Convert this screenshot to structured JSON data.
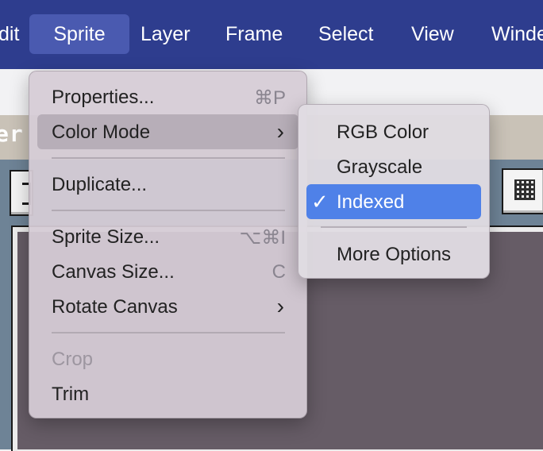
{
  "menubar": {
    "items": [
      "dit",
      "Sprite",
      "Layer",
      "Frame",
      "Select",
      "View",
      "Winde"
    ],
    "active": "Sprite"
  },
  "background": {
    "panel_title": "er"
  },
  "sprite_menu": {
    "properties": {
      "label": "Properties...",
      "shortcut": "⌘P"
    },
    "color_mode": {
      "label": "Color Mode"
    },
    "duplicate": {
      "label": "Duplicate..."
    },
    "sprite_size": {
      "label": "Sprite Size...",
      "shortcut": "⌥⌘I"
    },
    "canvas_size": {
      "label": "Canvas Size...",
      "shortcut": "C"
    },
    "rotate_canvas": {
      "label": "Rotate Canvas"
    },
    "crop": {
      "label": "Crop"
    },
    "trim": {
      "label": "Trim"
    }
  },
  "color_mode_submenu": {
    "rgb": "RGB Color",
    "grayscale": "Grayscale",
    "indexed": "Indexed",
    "more_options": "More Options",
    "checkmark": "✓"
  },
  "colors": {
    "menubar": "#2e3d8e",
    "selection": "#4f81e8",
    "canvas": "#665c66"
  }
}
